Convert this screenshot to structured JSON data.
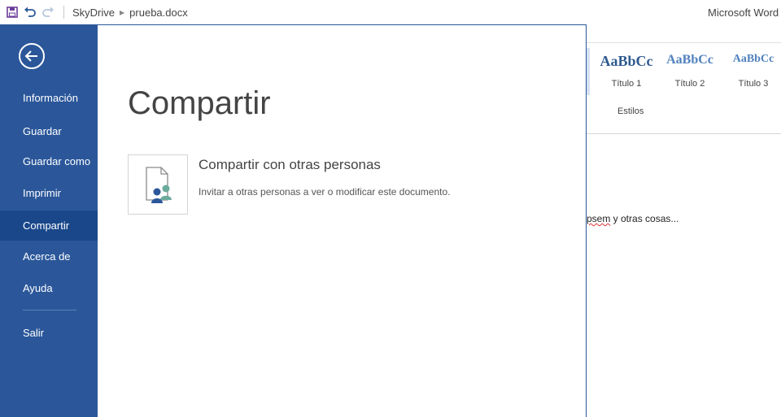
{
  "titlebar": {
    "breadcrumb": [
      "SkyDrive",
      "prueba.docx"
    ],
    "app_title": "Microsoft Word V",
    "icons": [
      "save-icon",
      "undo-icon",
      "redo-icon"
    ]
  },
  "nav": {
    "items": [
      {
        "label": "Información"
      },
      {
        "label": "Guardar"
      },
      {
        "label": "Guardar como"
      },
      {
        "label": "Imprimir"
      },
      {
        "label": "Compartir",
        "selected": true
      },
      {
        "label": "Acerca de"
      },
      {
        "label": "Ayuda"
      },
      {
        "label": "Salir"
      }
    ],
    "colors": {
      "background": "#2b579a",
      "selected": "#19478a"
    }
  },
  "panel": {
    "title": "Compartir",
    "option": {
      "heading": "Compartir con otras personas",
      "description": "Invitar a otras personas a ver o modificar este documento.",
      "icon": "share-people-document-icon"
    }
  },
  "ribbon": {
    "styles": [
      {
        "sample": "AaBbCc",
        "name": "Título 1"
      },
      {
        "sample": "AaBbCc",
        "name": "Título 2"
      },
      {
        "sample": "AaBbCc",
        "name": "Título 3"
      }
    ],
    "group_label": "Estilos"
  },
  "document": {
    "text_misspelled": "psem",
    "text_rest": " y otras cosas..."
  }
}
